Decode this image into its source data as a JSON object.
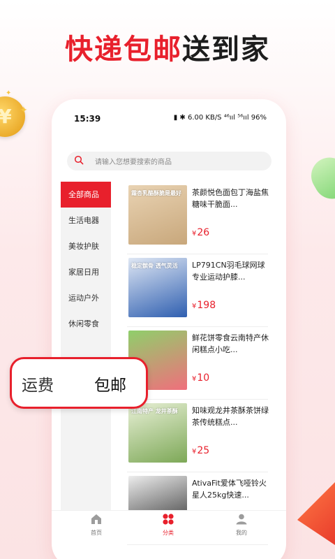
{
  "promo": {
    "headline_red": "快递包邮",
    "headline_dark": "送到家",
    "bubble_label": "运费",
    "bubble_value": "包邮"
  },
  "status_bar": {
    "time": "15:39",
    "indicators": "6.00 KB/S  ⁴⁶ııl  ⁵⁶ııl  96%",
    "battery": "96%"
  },
  "search": {
    "placeholder": "请输入您想要搜索的商品"
  },
  "categories": [
    {
      "label": "全部商品",
      "active": true
    },
    {
      "label": "生活电器"
    },
    {
      "label": "美妆护肤"
    },
    {
      "label": "家居日用"
    },
    {
      "label": "运动户外"
    },
    {
      "label": "休闲零食"
    }
  ],
  "products": [
    {
      "name": "茶颜悦色面包丁海盐焦糖味干脆面...",
      "price": "26",
      "currency": "¥",
      "thumb_text": "霜杏乳酪酥脆是最好",
      "thumb_colors": [
        "#c8a77b",
        "#e9d3b3"
      ]
    },
    {
      "name": "LP791CN羽毛球网球专业运动护膝...",
      "price": "198",
      "currency": "¥",
      "thumb_text": "稳定髌骨 透气灵活",
      "thumb_colors": [
        "#2f5fb0",
        "#dfe7f4"
      ]
    },
    {
      "name": "鲜花饼零食云南特产休闲糕点小吃...",
      "price": "10",
      "currency": "¥",
      "thumb_text": "",
      "thumb_colors": [
        "#f06f7c",
        "#8fcf6b"
      ]
    },
    {
      "name": "知味观龙井茶酥茶饼绿茶传统糕点...",
      "price": "25",
      "currency": "¥",
      "thumb_text": "江南特产 龙井茶酥",
      "thumb_colors": [
        "#7da857",
        "#e8f0d6"
      ]
    },
    {
      "name": "AtivaFit爱体飞哑铃火星人25kg快速...",
      "price": "",
      "currency": "",
      "thumb_text": "",
      "thumb_colors": [
        "#2b2b2b",
        "#ededed"
      ]
    }
  ],
  "tabbar": [
    {
      "label": "首页",
      "icon": "home-icon"
    },
    {
      "label": "分类",
      "icon": "category-icon",
      "active": true
    },
    {
      "label": "我的",
      "icon": "profile-icon"
    }
  ],
  "colors": {
    "accent": "#e8202c"
  }
}
